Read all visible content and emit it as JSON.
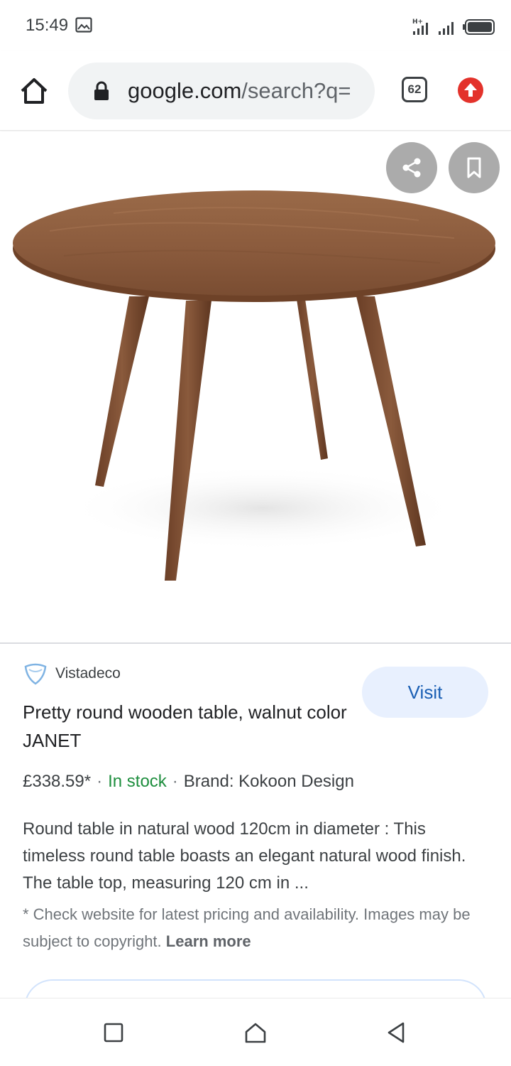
{
  "status_bar": {
    "time": "15:49",
    "icons": [
      "gallery-icon",
      "signal-hplus-icon",
      "signal-icon",
      "battery-icon"
    ]
  },
  "browser": {
    "url_domain": "google.com",
    "url_path": "/search?q=",
    "tab_count": "62",
    "icons": [
      "home-icon",
      "lock-icon",
      "update-icon"
    ],
    "update_color": "#e3322b"
  },
  "image_viewer": {
    "icons": [
      "share-icon",
      "bookmark-icon"
    ]
  },
  "result": {
    "source": "Vistadeco",
    "visit_label": "Visit",
    "title": "Pretty round wooden table, walnut color JANET",
    "price": "£338.59*",
    "stock": "In stock",
    "stock_color": "#1e8e3e",
    "brand": "Brand: Kokoon Design",
    "description": "Round table in natural wood 120cm in diameter : This timeless round table boasts an elegant natural wood finish. The table top, measuring 120 cm in ...",
    "disclaimer": "* Check website for latest pricing and availability. Images may be subject to copyright.",
    "learn_more": "Learn more",
    "accent_color": "#1a5fb4"
  },
  "nav_bar": {
    "icons": [
      "recent-apps-icon",
      "home-icon",
      "back-icon"
    ]
  }
}
